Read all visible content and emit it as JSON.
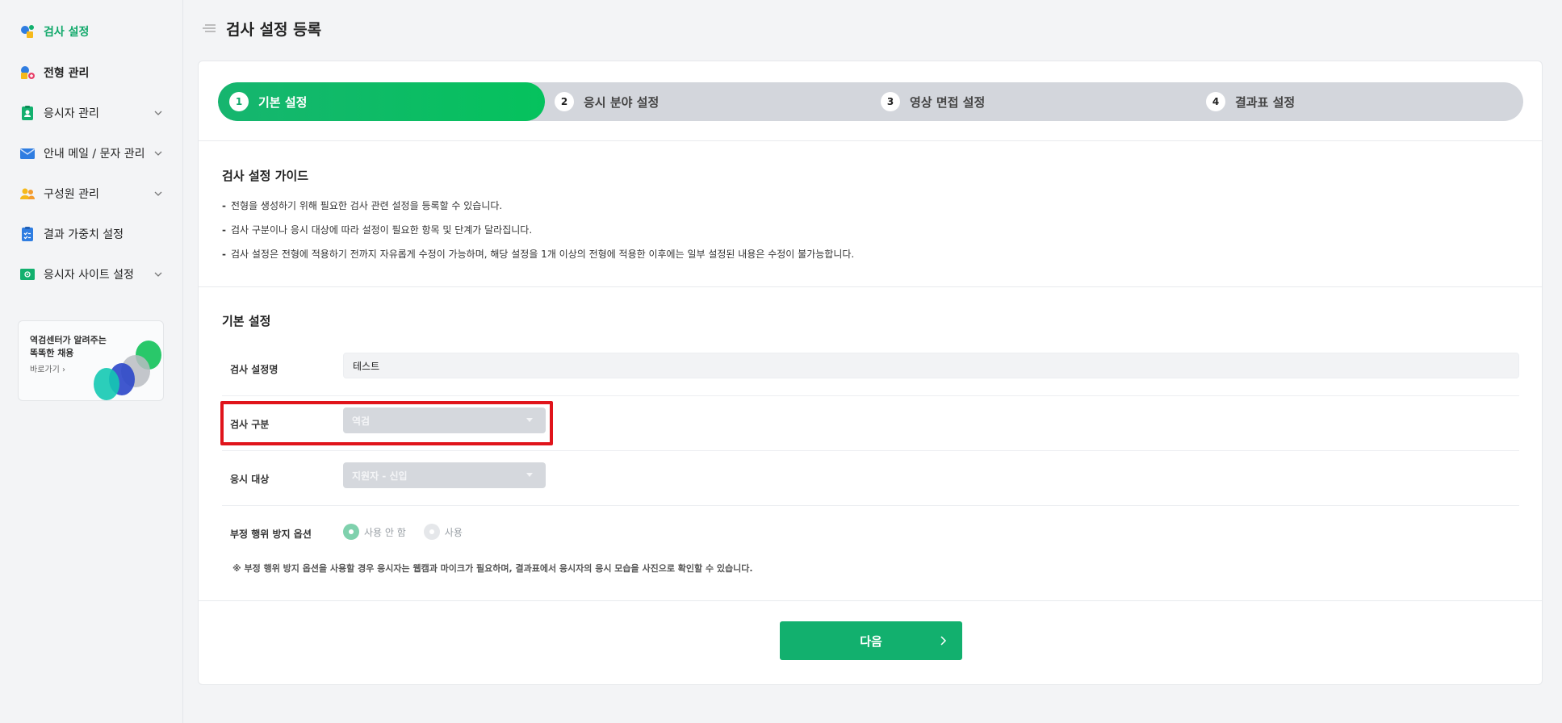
{
  "header": {
    "title": "검사 설정 등록"
  },
  "sidebar": {
    "items": [
      {
        "label": "검사 설정",
        "icon": "test-settings-icon",
        "active": true,
        "expandable": false
      },
      {
        "label": "전형 관리",
        "icon": "screening-icon",
        "active": false,
        "expandable": false
      },
      {
        "label": "응시자 관리",
        "icon": "applicant-badge-icon",
        "active": false,
        "expandable": true
      },
      {
        "label": "안내 메일 / 문자 관리",
        "icon": "mail-icon",
        "active": false,
        "expandable": true
      },
      {
        "label": "구성원 관리",
        "icon": "members-icon",
        "active": false,
        "expandable": true
      },
      {
        "label": "결과 가중치 설정",
        "icon": "checklist-icon",
        "active": false,
        "expandable": false
      },
      {
        "label": "응시자 사이트 설정",
        "icon": "site-settings-icon",
        "active": false,
        "expandable": true
      }
    ],
    "promo": {
      "line1": "역검센터가 알려주는",
      "line2": "똑똑한 채용",
      "link": "바로가기",
      "link_arrow": "›"
    }
  },
  "steps": [
    {
      "num": "1",
      "label": "기본 설정",
      "active": true
    },
    {
      "num": "2",
      "label": "응시 분야 설정",
      "active": false
    },
    {
      "num": "3",
      "label": "영상 면접 설정",
      "active": false
    },
    {
      "num": "4",
      "label": "결과표 설정",
      "active": false
    }
  ],
  "guide": {
    "title": "검사 설정 가이드",
    "bullet": "-",
    "lines": [
      "전형을 생성하기 위해 필요한 검사 관련 설정을 등록할 수 있습니다.",
      "검사 구분이나 응시 대상에 따라 설정이 필요한 항목 및 단계가 달라집니다.",
      "검사 설정은 전형에 적용하기 전까지 자유롭게 수정이 가능하며, 해당 설정을 1개 이상의 전형에 적용한 이후에는 일부 설정된 내용은 수정이 불가능합니다."
    ]
  },
  "basic": {
    "title": "기본 설정",
    "name_label": "검사 설정명",
    "name_value": "테스트",
    "type_label": "검사 구분",
    "type_value": "역검",
    "target_label": "응시 대상",
    "target_value": "지원자 - 신입",
    "cheat_label": "부정 행위 방지 옵션",
    "cheat_options": [
      "사용 안 함",
      "사용"
    ],
    "cheat_selected": 0,
    "note": "※ 부정 행위 방지 옵션을 사용할 경우 응시자는 웹캠과 마이크가 필요하며, 결과표에서 응시자의 응시 모습을 사진으로 확인할 수 있습니다."
  },
  "footer": {
    "next_label": "다음"
  },
  "colors": {
    "accent": "#12b06e",
    "highlight": "#e0141b",
    "disabled_select": "#d5d8dd"
  }
}
